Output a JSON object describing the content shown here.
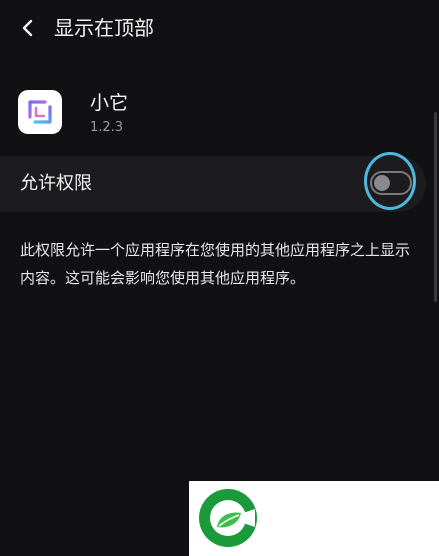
{
  "header": {
    "title": "显示在顶部",
    "back_icon": "chevron-left-icon"
  },
  "app": {
    "name": "小它",
    "version": "1.2.3",
    "icon": "app-icon"
  },
  "permission": {
    "label": "允许权限",
    "enabled": false
  },
  "description": "此权限允许一个应用程序在您使用的其他应用程序之上显示内容。这可能会影响您使用其他应用程序。",
  "watermark": {
    "icon": "leaf-logo-icon",
    "colors": {
      "green": "#1a9a3a",
      "light_green": "#3cbf4a"
    }
  },
  "colors": {
    "background": "#111113",
    "row_background": "#1c1c1f",
    "focus_ring": "#4fb8e0",
    "muted_text": "#9a9a9e"
  }
}
